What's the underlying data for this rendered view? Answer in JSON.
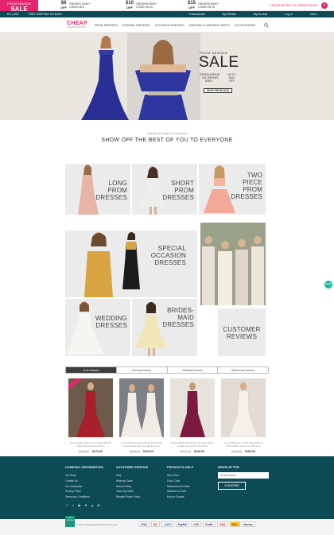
{
  "promo": {
    "sale_top": "PROM SEASON",
    "sale_big": "SALE",
    "offers": [
      {
        "big": "$8",
        "off": "OFF",
        "line1": "ORDERS $180+",
        "line2": "CODE:H8 8"
      },
      {
        "big": "$10",
        "off": "OFF",
        "line1": "ORDERS $240+",
        "line2": "CODE:H8 10"
      },
      {
        "big": "$15",
        "off": "OFF",
        "line1": "ORDERS $300+",
        "line2": "CODE:H8 15"
      }
    ],
    "link": "FREESHIPPING ON ORDERS $180+",
    "close": "×",
    "colors": {
      "accent": "#e6246e"
    }
  },
  "topbar": {
    "lang": "EN | USD",
    "shipping": "FREE SHIPPING ON $180+",
    "right": [
      "Professionals",
      "My Wishlist",
      "My Account",
      "Log In",
      "Cart 0"
    ],
    "color": "#0c4a55"
  },
  "nav": {
    "logo": "CHEAP",
    "logo_sub": "FORMAL DRESSES",
    "menu": [
      "PROM DRESSES",
      "EVENING DRESSES",
      "OCCASION DRESSES",
      "WEDDING & WEDDING PARTY",
      "ACCESSORIES"
    ],
    "search_icon": "search-icon"
  },
  "hero": {
    "sub": "PROM SEASON",
    "sale": "SALE",
    "lines": [
      "FREESHIPPING",
      "ON ORDERS",
      "$180+",
      "UP TO",
      "80%",
      "OFF"
    ],
    "button": "SHOP PROM NOW"
  },
  "section": {
    "small": "Selected by Cheap Formal Dresses",
    "tagline": "SHOW OFF THE BEST OF YOU TO EVERYONE"
  },
  "tiles": [
    {
      "label": "LONG\nPROM\nDRESSES"
    },
    {
      "label": "SHORT\nPROM\nDRESSES"
    },
    {
      "label": "TWO\nPIECE\nPROM\nDRESSES"
    },
    {
      "label": "SPECIAL\nOCCASION\nDRESSES"
    },
    {
      "label": "WEDDING\nDRESSES"
    },
    {
      "label": "BRIDES-\nMAID\nDRESSES"
    },
    {
      "label": "CUSTOMER\nREVIEWS"
    }
  ],
  "tabs": [
    "Prom Dresses",
    "Evening Dresses",
    "Wedding Dresses",
    "Bridesmaid Dresses"
  ],
  "products": [
    {
      "name": "Trumpet/Mermaid V-neck Sweep/Brush Train Tulle Sequined Prom",
      "old": "$365.00",
      "new": "$173.00",
      "color": "#a8202c",
      "bg": "#6d5a4a"
    },
    {
      "name": "A-Line/Princess Sweetheart Tulle Satin Prom Dress Floor-Length Evening",
      "old": "$298.00",
      "new": "$163.00",
      "color": "#f2ece6",
      "bg": "#7d7f85"
    },
    {
      "name": "Trumpet/Mermaid Off-the-Shoulder Floor-Length Jersey Prom Evening",
      "old": "$317.00",
      "new": "$142.00",
      "color": "#7a1a3e",
      "bg": "#e7e2dc"
    },
    {
      "name": "A-Line/Princess V-neck Sweep/Brush Train Chiffon Lace Prom Dresses",
      "old": "$319.00",
      "new": "$166.00",
      "color": "#eee6df",
      "bg": "#e2dcd4"
    }
  ],
  "footer": {
    "cols": [
      {
        "title": "COMPANY INFORMATION",
        "links": [
          "Our Story",
          "Contact Us",
          "Our Guarantee",
          "Privacy Policy",
          "Terms and Conditions"
        ]
      },
      {
        "title": "CUSTOMER SERVICE",
        "links": [
          "FAQ",
          "Delivery Guide",
          "Return Policy",
          "Track My Order",
          "Reward Points Policy"
        ]
      },
      {
        "title": "PRODUCTS HELP",
        "links": [
          "Size Chart",
          "Color Chart",
          "Measurement Guide",
          "Alteration & Care",
          "How to Choose"
        ]
      }
    ],
    "newsletter": "NEWSLETTER",
    "email_placeholder": "Email Address",
    "subscribe": "SUBSCRIBE",
    "social": [
      "f",
      "t",
      "▶",
      "♥",
      "g",
      "◎"
    ],
    "copyright": "© 2017 www.cheapformaldresses.com",
    "badge": "SSL SECURE",
    "payments": [
      "VISA",
      "MC",
      "AMEX",
      "PayPal",
      "UPS",
      "FedEx",
      "EMS",
      "DHL",
      "Norton"
    ]
  },
  "chat": "CHAT"
}
